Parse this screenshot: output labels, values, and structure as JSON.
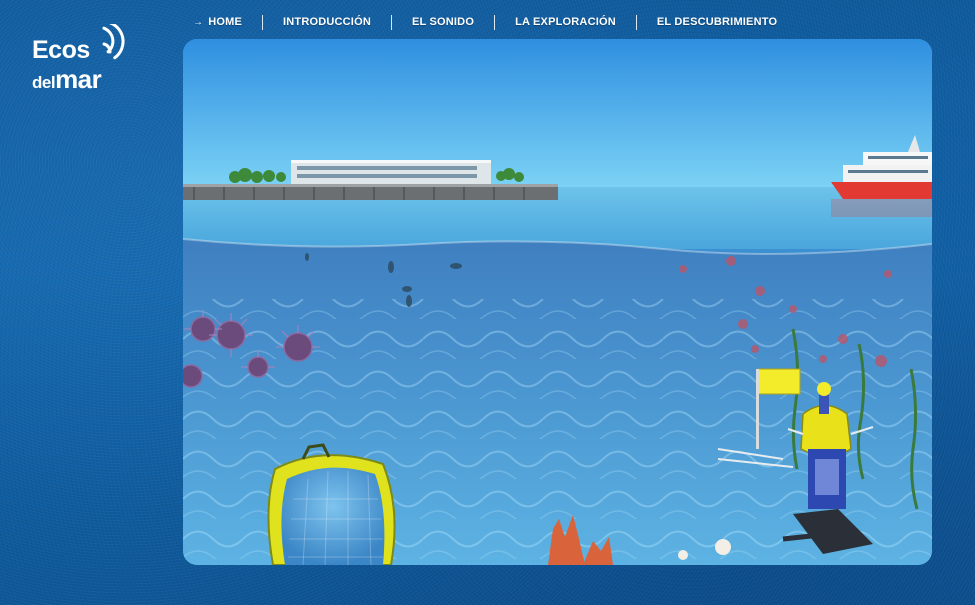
{
  "logo": {
    "line1": "Ecos",
    "line2_small": "del",
    "line2_big": "mar"
  },
  "nav": {
    "items": [
      {
        "label": "HOME",
        "active": true
      },
      {
        "label": "INTRODUCCIÓN",
        "active": false
      },
      {
        "label": "EL SONIDO",
        "active": false
      },
      {
        "label": "LA EXPLORACIÓN",
        "active": false
      },
      {
        "label": "EL DESCUBRIMIENTO",
        "active": false
      }
    ],
    "active_arrow": "→"
  },
  "colors": {
    "background": "#1266ad",
    "sky": "#4fb3ec",
    "water_surface": "#5cb6e6",
    "underwater": "#3f93cf",
    "ship_hull": "#e23a33",
    "buoy_yellow": "#e9e21a",
    "flag_yellow": "#f2ec2a"
  }
}
